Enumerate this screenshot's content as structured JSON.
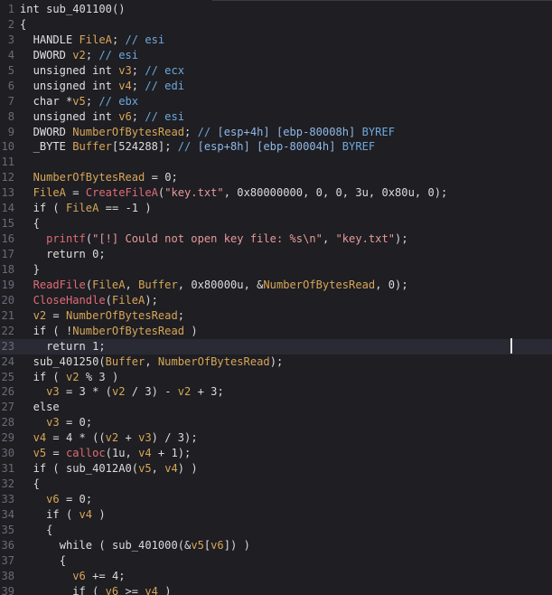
{
  "editor": {
    "language": "pseudocode",
    "lines": [
      {
        "n": "1",
        "text": "int sub_401100()"
      },
      {
        "n": "2",
        "text": "{"
      },
      {
        "n": "3",
        "text": "  HANDLE FileA; // esi"
      },
      {
        "n": "4",
        "text": "  DWORD v2; // esi"
      },
      {
        "n": "5",
        "text": "  unsigned int v3; // ecx"
      },
      {
        "n": "6",
        "text": "  unsigned int v4; // edi"
      },
      {
        "n": "7",
        "text": "  char *v5; // ebx"
      },
      {
        "n": "8",
        "text": "  unsigned int v6; // esi"
      },
      {
        "n": "9",
        "text": "  DWORD NumberOfBytesRead; // [esp+4h] [ebp-80008h] BYREF"
      },
      {
        "n": "10",
        "text": "  _BYTE Buffer[524288]; // [esp+8h] [ebp-80004h] BYREF"
      },
      {
        "n": "11",
        "text": ""
      },
      {
        "n": "12",
        "text": "  NumberOfBytesRead = 0;"
      },
      {
        "n": "13",
        "text": "  FileA = CreateFileA(\"key.txt\", 0x80000000, 0, 0, 3u, 0x80u, 0);"
      },
      {
        "n": "14",
        "text": "  if ( FileA == -1 )"
      },
      {
        "n": "15",
        "text": "  {"
      },
      {
        "n": "16",
        "text": "    printf(\"[!] Could not open key file: %s\\n\", \"key.txt\");"
      },
      {
        "n": "17",
        "text": "    return 0;"
      },
      {
        "n": "18",
        "text": "  }"
      },
      {
        "n": "19",
        "text": "  ReadFile(FileA, Buffer, 0x80000u, &NumberOfBytesRead, 0);"
      },
      {
        "n": "20",
        "text": "  CloseHandle(FileA);"
      },
      {
        "n": "21",
        "text": "  v2 = NumberOfBytesRead;"
      },
      {
        "n": "22",
        "text": "  if ( !NumberOfBytesRead )"
      },
      {
        "n": "23",
        "text": "    return 1;"
      },
      {
        "n": "24",
        "text": "  sub_401250(Buffer, NumberOfBytesRead);"
      },
      {
        "n": "25",
        "text": "  if ( v2 % 3 )"
      },
      {
        "n": "26",
        "text": "    v3 = 3 * (v2 / 3) - v2 + 3;"
      },
      {
        "n": "27",
        "text": "  else"
      },
      {
        "n": "28",
        "text": "    v3 = 0;"
      },
      {
        "n": "29",
        "text": "  v4 = 4 * ((v2 + v3) / 3);"
      },
      {
        "n": "30",
        "text": "  v5 = calloc(1u, v4 + 1);"
      },
      {
        "n": "31",
        "text": "  if ( sub_4012A0(v5, v4) )"
      },
      {
        "n": "32",
        "text": "  {"
      },
      {
        "n": "33",
        "text": "    v6 = 0;"
      },
      {
        "n": "34",
        "text": "    if ( v4 )"
      },
      {
        "n": "35",
        "text": "    {"
      },
      {
        "n": "36",
        "text": "      while ( sub_401000(&v5[v6]) )"
      },
      {
        "n": "37",
        "text": "      {"
      },
      {
        "n": "38",
        "text": "        v6 += 4;"
      },
      {
        "n": "39",
        "text": "        if ( v6 >= v4 )"
      }
    ],
    "current_line": "23"
  },
  "colors": {
    "background": "#1e1e23",
    "line_number": "#6b6b78",
    "local_variable": "#d8a657",
    "global_name": "#6fa8dc",
    "api_call": "#e06c75",
    "string": "#e89a9a",
    "text": "#dcdcdc",
    "comment_reference": "#8fb8e6"
  }
}
